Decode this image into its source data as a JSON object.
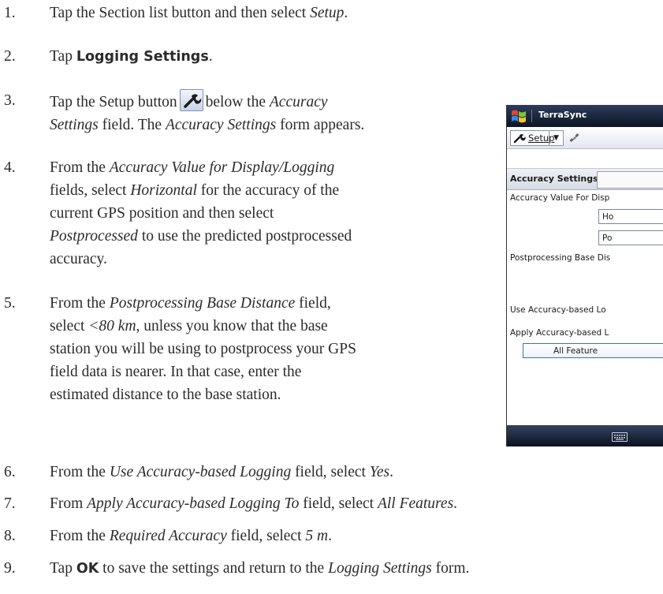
{
  "steps": [
    {
      "num": "1.",
      "lines": [
        [
          "Tap the Section list button and then select ",
          "Setup",
          "."
        ]
      ]
    },
    {
      "num": "2.",
      "pre": "Tap ",
      "bold": "Logging Settings",
      "post": "."
    },
    {
      "num": "3.",
      "pre": "Tap the Setup button",
      "post_a": "below the ",
      "italic_a": "Accuracy",
      "line2_italic": "Settings",
      "line2_rest": " field. The ",
      "line2_italic2": "Accuracy Settings",
      "line2_end": " form appears."
    },
    {
      "num": "4.",
      "l1_pre": "From the ",
      "l1_it": "Accuracy Value for Display/Logging",
      "l2": "fields, select ",
      "l2_it": "Horizontal",
      "l2_end": " for the accuracy of the",
      "l3": "current GPS position and then select",
      "l4_it": "Postprocessed",
      "l4_end": " to use the predicted postprocessed",
      "l5": "accuracy."
    },
    {
      "num": "5.",
      "l1_pre": "From the ",
      "l1_it": "Postprocessing Base Distance",
      "l1_end": " field,",
      "l2": "select ",
      "l2_it": "<80 km",
      "l2_end": ", unless you know that the base",
      "l3": "station you will be using to postprocess your GPS",
      "l4": "field data is nearer. In that case, enter the",
      "l5": "estimated distance to the base station."
    },
    {
      "num": "6.",
      "pre": "From the ",
      "it": "Use Accuracy-based Logging",
      "mid": " field, select ",
      "it2": "Yes",
      "end": "."
    },
    {
      "num": "7.",
      "pre": "From ",
      "it": "Apply Accuracy-based Logging To",
      "mid": " field, select ",
      "it2": "All Features",
      "end": "."
    },
    {
      "num": "8.",
      "pre": "From the ",
      "it": "Required Accuracy",
      "mid": " field, select ",
      "it2": "5 m",
      "end": "."
    },
    {
      "num": "9.",
      "pre": "Tap ",
      "bold": "OK",
      "mid": " to save the settings and return to the ",
      "it": "Logging Settings",
      "end": " form."
    }
  ],
  "device": {
    "app_title": "TerraSync",
    "section_button": "Setup",
    "form_title": "Accuracy Settings",
    "labels": {
      "accuracy_value": "Accuracy Value For Disp",
      "base_distance": "Postprocessing Base Dis",
      "use_logging": "Use Accuracy-based Lo",
      "apply_logging": "Apply Accuracy-based L"
    },
    "values": {
      "horizontal": "Ho",
      "postprocessed": "Po",
      "all_features": "All Feature"
    }
  }
}
